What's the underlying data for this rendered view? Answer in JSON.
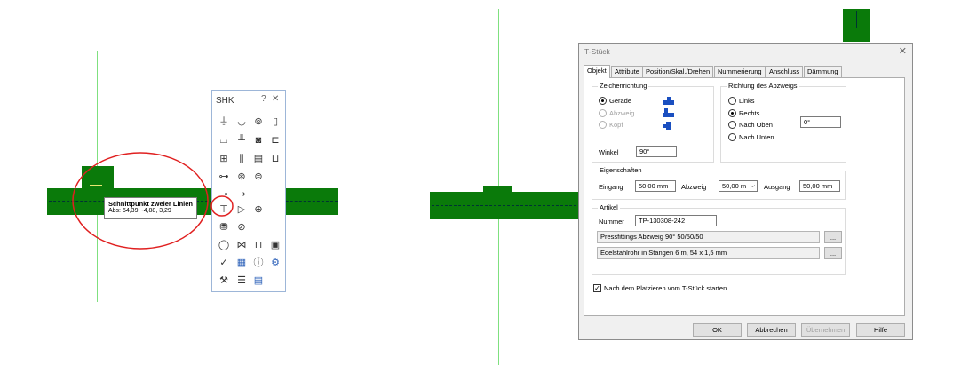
{
  "toolbar": {
    "title": "SHK",
    "help": "?",
    "close": "✕"
  },
  "tooltip": {
    "title": "Schnittpunkt zweier Linien",
    "coords": "Abs: 54,39, -4,88, 3,29"
  },
  "dialog": {
    "title": "T-Stück",
    "close": "✕",
    "tabs": [
      "Objekt",
      "Attribute",
      "Position/Skal./Drehen",
      "Nummerierung",
      "Anschluss",
      "Dämmung"
    ],
    "zeichenrichtung": {
      "label": "Zeichenrichtung",
      "options": [
        "Gerade",
        "Abzweig",
        "Kopf"
      ],
      "winkel_label": "Winkel",
      "winkel_value": "90°"
    },
    "richtung": {
      "label": "Richtung des Abzweigs",
      "options": [
        "Links",
        "Rechts",
        "Nach Oben",
        "Nach Unten"
      ],
      "angle_value": "0°"
    },
    "eigenschaften": {
      "label": "Eigenschaften",
      "eingang_label": "Eingang",
      "eingang_value": "50,00 mm",
      "abzweig_label": "Abzweig",
      "abzweig_value": "50,00 m",
      "ausgang_label": "Ausgang",
      "ausgang_value": "50,00 mm"
    },
    "artikel": {
      "label": "Artikel",
      "nummer_label": "Nummer",
      "nummer_value": "TP-130308-242",
      "line1": "Pressfittings Abzweig 90° 50/50/50",
      "line2": "Edelstahlrohr in Stangen 6 m, 54 x 1,5 mm",
      "browse": "..."
    },
    "checkbox_label": "Nach dem Platzieren vom T-Stück starten",
    "buttons": {
      "ok": "OK",
      "cancel": "Abbrechen",
      "apply": "Übernehmen",
      "help": "Hilfe"
    }
  },
  "colors": {
    "pipe": "#0a7a0a",
    "guide": "#7fe07f",
    "highlight": "#e02020"
  }
}
